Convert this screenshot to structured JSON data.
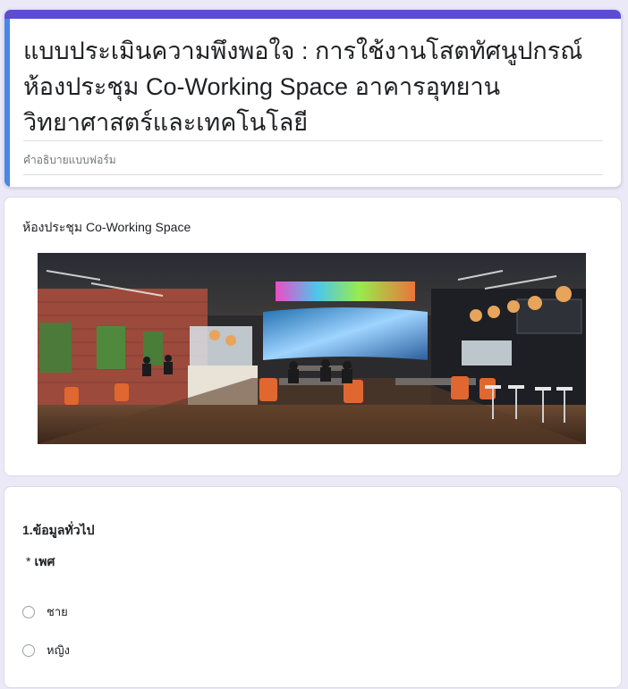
{
  "header": {
    "title": "แบบประเมินความพึงพอใจ : การใช้งานโสตทัศนูปกรณ์ ห้องประชุม Co-Working Space อาคารอุทยานวิทยาศาสตร์และเทคโนโลยี",
    "description_placeholder": "คำอธิบายแบบฟอร์ม"
  },
  "image_section": {
    "title": "ห้องประชุม Co-Working Space",
    "image_alt": "co-working-space-photo"
  },
  "general_section": {
    "title": "1.ข้อมูลทั่วไป",
    "question": {
      "required_marker": "*",
      "label": "เพศ",
      "options": [
        {
          "label": "ชาย",
          "selected": false
        },
        {
          "label": "หญิง",
          "selected": false
        }
      ]
    }
  },
  "colors": {
    "accent_top": "#5b4bd6",
    "accent_left": "#4a86e8",
    "page_bg": "#ebe8f7"
  }
}
